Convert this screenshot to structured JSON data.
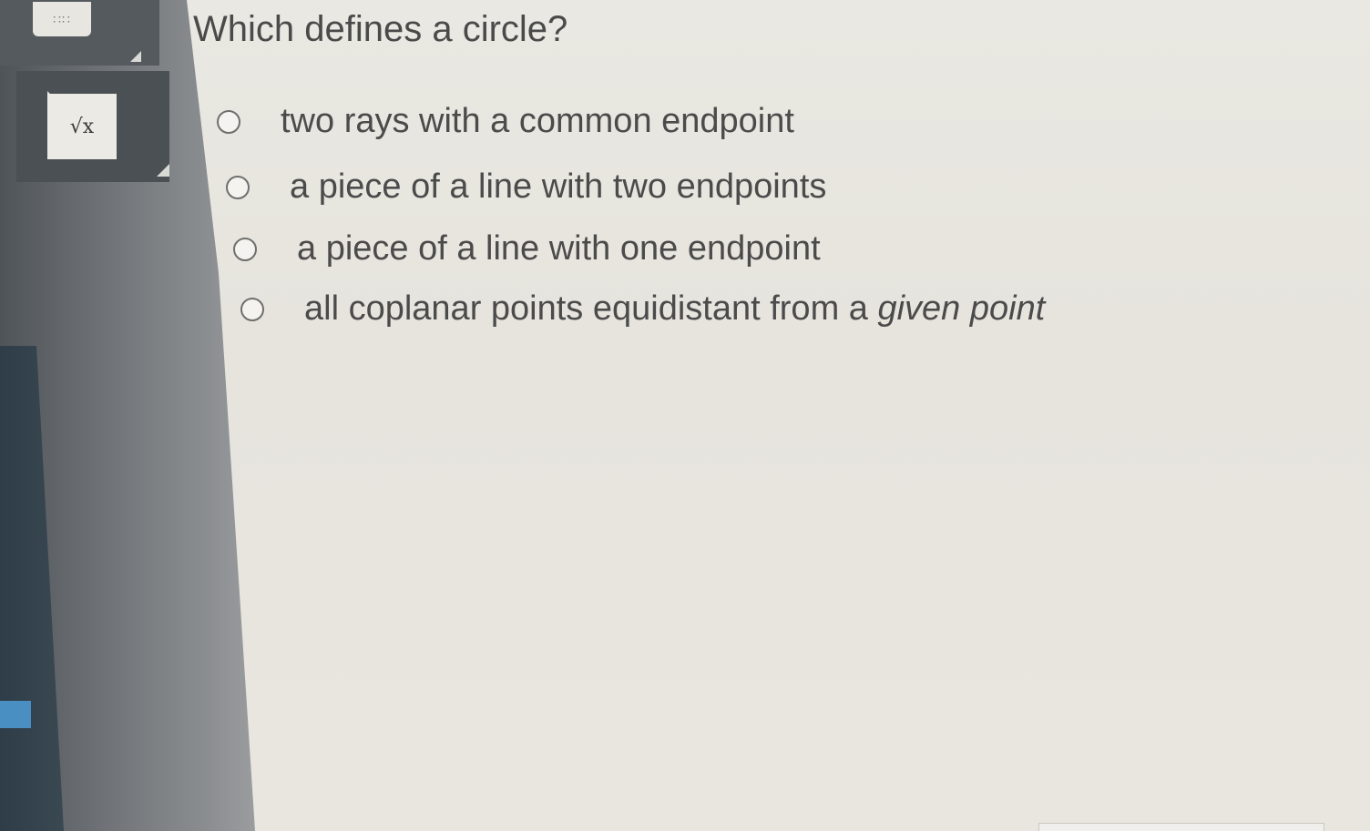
{
  "question": {
    "text": "Which defines a circle?"
  },
  "toolbar": {
    "sqrt_button_label": "√x",
    "grid_icon_label": "∷∷",
    "icons": [
      "keypad-icon",
      "square-root-icon"
    ]
  },
  "options": [
    {
      "label": "two rays with a common endpoint",
      "selected": false
    },
    {
      "label": "a piece of a line with two endpoints",
      "selected": false
    },
    {
      "label": "a piece of a line with one endpoint",
      "selected": false
    },
    {
      "label_prefix": "all coplanar points equidistant from a ",
      "label_italic": "given point",
      "selected": false
    }
  ],
  "colors": {
    "background": "#e9e8e2",
    "text": "#4a4a4a",
    "sidebar": "#555a5e"
  }
}
